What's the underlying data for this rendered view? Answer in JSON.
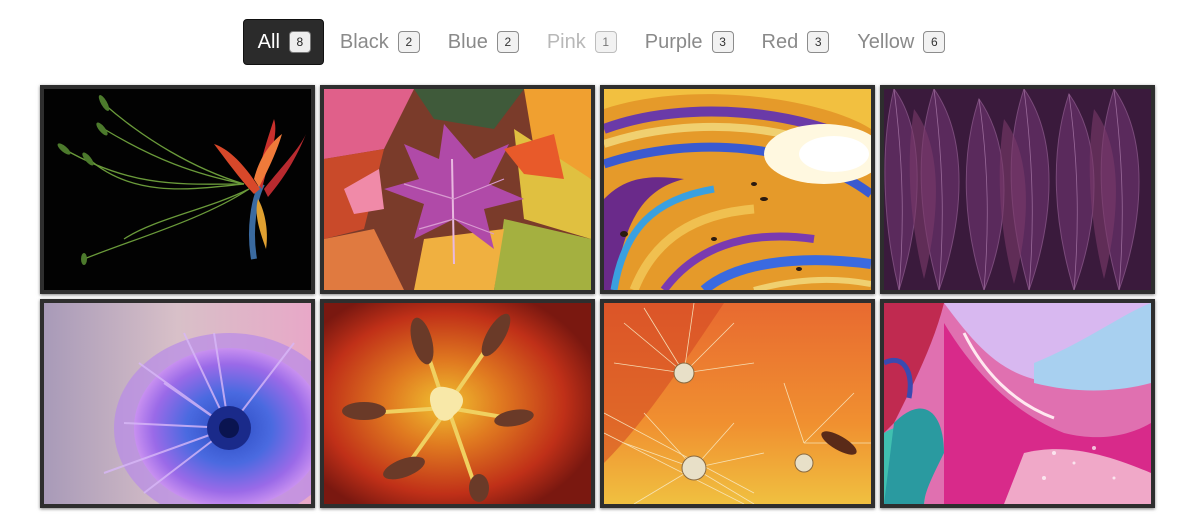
{
  "filters": [
    {
      "label": "All",
      "count": "8"
    },
    {
      "label": "Black",
      "count": "2"
    },
    {
      "label": "Blue",
      "count": "2"
    },
    {
      "label": "Pink",
      "count": "1"
    },
    {
      "label": "Purple",
      "count": "3"
    },
    {
      "label": "Red",
      "count": "3"
    },
    {
      "label": "Yellow",
      "count": "6"
    }
  ],
  "active_filter": "All",
  "disabled_filter": "Pink",
  "gallery": [
    {
      "name": "photo-lily-on-black"
    },
    {
      "name": "photo-autumn-leaves"
    },
    {
      "name": "photo-soap-bubble-swirl"
    },
    {
      "name": "photo-purple-leaves"
    },
    {
      "name": "photo-blue-chrysanthemum"
    },
    {
      "name": "photo-lily-stamens-macro"
    },
    {
      "name": "photo-dandelion-dew"
    },
    {
      "name": "photo-alcohol-ink-art"
    }
  ],
  "colors": {
    "active_bg": "#2b2b2b",
    "inactive_text": "#8a8a8a",
    "tile_border": "#2e2e2e"
  }
}
